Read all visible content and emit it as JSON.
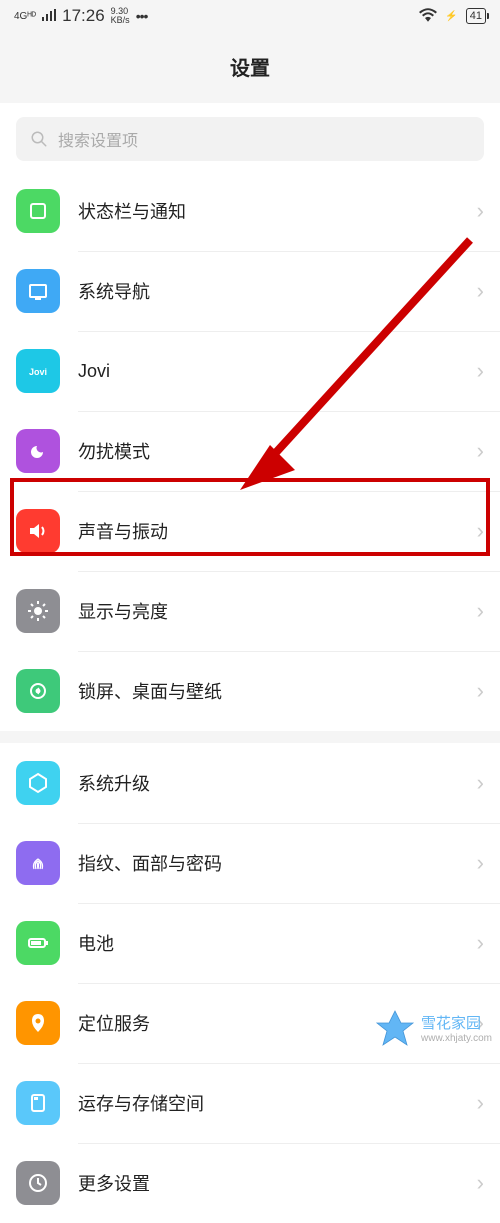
{
  "status_bar": {
    "net_label": "4Gᴴᴰ",
    "time": "17:26",
    "kbs_top": "9.30",
    "kbs_bottom": "KB/s",
    "battery": "41"
  },
  "header": {
    "title": "设置"
  },
  "search": {
    "placeholder": "搜索设置项"
  },
  "group1": [
    {
      "id": "statusbar",
      "label": "状态栏与通知",
      "icon": "statusbar"
    },
    {
      "id": "sysnav",
      "label": "系统导航",
      "icon": "nav"
    },
    {
      "id": "jovi",
      "label": "Jovi",
      "icon": "jovi"
    },
    {
      "id": "dnd",
      "label": "勿扰模式",
      "icon": "dnd"
    },
    {
      "id": "sound",
      "label": "声音与振动",
      "icon": "sound"
    },
    {
      "id": "display",
      "label": "显示与亮度",
      "icon": "display"
    },
    {
      "id": "lockscreen",
      "label": "锁屏、桌面与壁纸",
      "icon": "lock"
    }
  ],
  "group2": [
    {
      "id": "upgrade",
      "label": "系统升级",
      "icon": "upgrade"
    },
    {
      "id": "fingerprint",
      "label": "指纹、面部与密码",
      "icon": "finger"
    },
    {
      "id": "battery",
      "label": "电池",
      "icon": "battery"
    },
    {
      "id": "location",
      "label": "定位服务",
      "icon": "location"
    },
    {
      "id": "storage",
      "label": "运存与存储空间",
      "icon": "storage"
    },
    {
      "id": "more",
      "label": "更多设置",
      "icon": "more"
    }
  ],
  "watermark": {
    "brand": "雪花家园",
    "url": "www.xhjaty.com"
  }
}
